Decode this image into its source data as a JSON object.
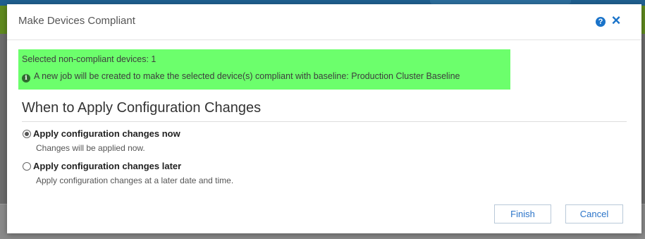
{
  "dialog": {
    "title": "Make Devices Compliant",
    "help_icon": "question-circle-icon",
    "close_icon": "close-x-icon"
  },
  "notice": {
    "selected_text": "Selected non-compliant devices: 1",
    "info_icon": "info-circle-icon",
    "message": "A new job will be created to make the selected device(s) compliant with baseline: Production Cluster Baseline",
    "highlight_color": "#6cff6c"
  },
  "section": {
    "title": "When to Apply Configuration Changes"
  },
  "options": [
    {
      "label": "Apply configuration changes now",
      "description": "Changes will be applied now.",
      "selected": true
    },
    {
      "label": "Apply configuration changes later",
      "description": "Apply configuration changes at a later date and time.",
      "selected": false
    }
  ],
  "buttons": {
    "finish": "Finish",
    "cancel": "Cancel"
  },
  "colors": {
    "accent": "#1a73c9",
    "top_bar": "#1f5f8f",
    "green_bar": "#5f8a1f"
  }
}
